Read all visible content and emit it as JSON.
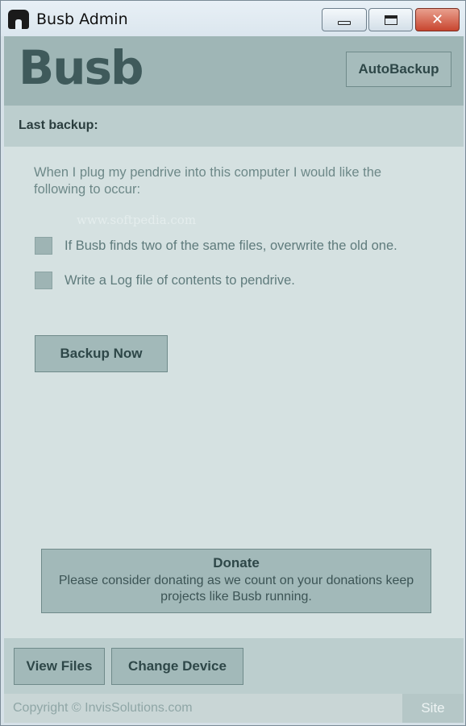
{
  "window": {
    "title": "Busb Admin",
    "controls": {
      "minimize": "minimize",
      "maximize": "maximize",
      "close": "✕"
    }
  },
  "header": {
    "logo": "Busb",
    "autobackup_label": "AutoBackup"
  },
  "status": {
    "last_backup_label": "Last backup:"
  },
  "main": {
    "intro": "When I plug my pendrive into this computer I would like the following to occur:",
    "watermark": "www.softpedia.com",
    "options": [
      {
        "label": "If Busb finds two of the same files, overwrite the old one.",
        "checked": false
      },
      {
        "label": "Write a Log file of contents to pendrive.",
        "checked": false
      }
    ],
    "backup_now_label": "Backup Now",
    "donate": {
      "title": "Donate",
      "body": "Please consider donating as we count on your donations keep projects like Busb running."
    }
  },
  "bottom": {
    "view_files_label": "View Files",
    "change_device_label": "Change Device"
  },
  "footer": {
    "copyright": "Copyright © InvisSolutions.com",
    "site_label": "Site"
  },
  "colors": {
    "header_bg": "#9fb6b6",
    "main_bg": "#d5e1e1",
    "button_bg": "#a2b9b9",
    "logo": "#3f5a5b"
  }
}
